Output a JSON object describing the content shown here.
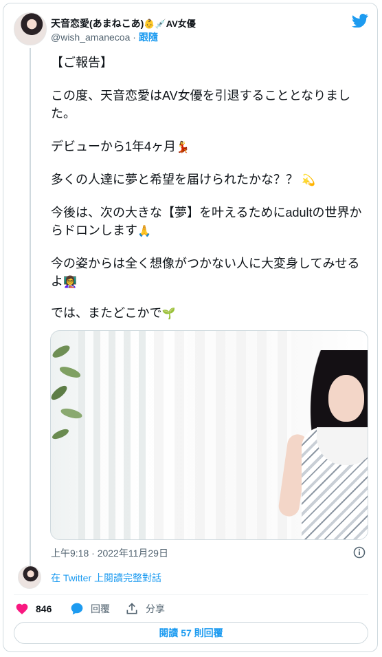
{
  "author": {
    "display_name": "天音恋愛(あまねこあ)",
    "name_emojis": "👶💉AV女優",
    "handle": "@wish_amanecoa",
    "separator": "·",
    "follow_label": "跟隨"
  },
  "tweet": {
    "lines": [
      "【ご報告】",
      "この度、天音恋愛はAV女優を引退することとなりました。",
      "デビューから1年4ヶ月",
      "多くの人達に夢と希望を届けられたかな？？",
      "今後は、次の大きな【夢】を叶えるためにadultの世界からドロンします",
      "今の姿からは全く想像がつかない人に大変身してみせるよ",
      "では、またどこかで"
    ],
    "emojis": [
      "💃",
      "💫",
      "🙏",
      "👩‍🏫",
      "🌱"
    ]
  },
  "timestamp": "上午9:18 · 2022年11月29日",
  "thread_link": "在 Twitter 上閱讀完整對話",
  "actions": {
    "like_count": "846",
    "reply_label": "回覆",
    "share_label": "分享"
  },
  "read_replies": "閱讀 57 則回覆",
  "colors": {
    "accent": "#1d9bf0",
    "like": "#f91880",
    "text": "#0f1419",
    "muted": "#536471"
  },
  "icons": [
    "twitter-bird-icon",
    "info-icon",
    "heart-icon",
    "reply-icon",
    "share-icon"
  ]
}
